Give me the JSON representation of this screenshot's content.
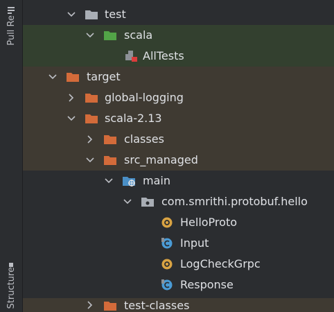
{
  "sidebar": {
    "pull_requests_label": "Pull Re",
    "structure_label": "Structure"
  },
  "tree": {
    "nodes": [
      {
        "label": "test"
      },
      {
        "label": "scala"
      },
      {
        "label": "AllTests"
      },
      {
        "label": "target"
      },
      {
        "label": "global-logging"
      },
      {
        "label": "scala-2.13"
      },
      {
        "label": "classes"
      },
      {
        "label": "src_managed"
      },
      {
        "label": "main"
      },
      {
        "label": "com.smrithi.protobuf.hello"
      },
      {
        "label": "HelloProto"
      },
      {
        "label": "Input"
      },
      {
        "label": "LogCheckGrpc"
      },
      {
        "label": "Response"
      },
      {
        "label": "test-classes"
      }
    ]
  },
  "colors": {
    "background": "#2b2d30",
    "test_scope_row": "#33402f",
    "excluded_row": "#3f3a32",
    "excluded_folder": "#d36b3a",
    "test_folder": "#52a447",
    "plain_folder": "#a9aeb5",
    "object_icon": "#d9a343",
    "class_icon": "#4a9bd6"
  }
}
